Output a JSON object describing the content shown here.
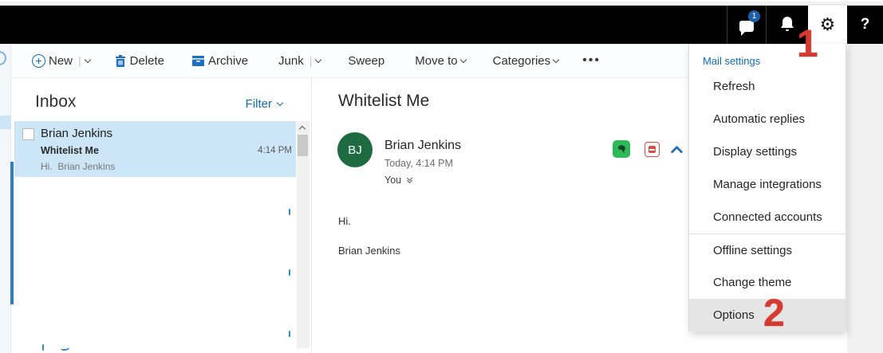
{
  "topbar": {
    "badge_count": "1",
    "help_label": "?",
    "gear_glyph": "⚙"
  },
  "toolbar": {
    "new_label": "New",
    "delete_label": "Delete",
    "archive_label": "Archive",
    "junk_label": "Junk",
    "sweep_label": "Sweep",
    "move_to_label": "Move to",
    "categories_label": "Categories",
    "more_label": "•••",
    "plus_glyph": "+"
  },
  "list_pane": {
    "title": "Inbox",
    "filter_label": "Filter",
    "email": {
      "sender": "Brian Jenkins",
      "subject": "Whitelist Me",
      "preview": "Hi.  Brian Jenkins",
      "time": "4:14 PM"
    }
  },
  "reading_pane": {
    "subject": "Whitelist Me",
    "avatar_initials": "BJ",
    "sender": "Brian Jenkins",
    "timestamp": "Today, 4:14 PM",
    "recipient": "You",
    "body_lines": {
      "0": "Hi.",
      "1": "Brian Jenkins"
    }
  },
  "settings_menu": {
    "header": "Mail settings",
    "items": {
      "0": "Refresh",
      "1": "Automatic replies",
      "2": "Display settings",
      "3": "Manage integrations",
      "4": "Connected accounts",
      "5": "Offline settings",
      "6": "Change theme",
      "7": "Options"
    },
    "highlighted_item": "Options"
  },
  "annotations": {
    "step1": "1",
    "step2": "2",
    "color": "#d53a30"
  },
  "colors": {
    "accent_blue": "#0f6cbd",
    "selected_row_blue": "#cde6f7",
    "avatar_green": "#1e6b41",
    "evernote_green": "#2eb857",
    "menu_highlight": "#e5e5e5",
    "topbar_black": "#000000"
  },
  "icons": {
    "feedback": "chat-bubble-icon",
    "notifications": "bell-icon",
    "settings": "gear-icon",
    "help": "question-mark-icon"
  }
}
